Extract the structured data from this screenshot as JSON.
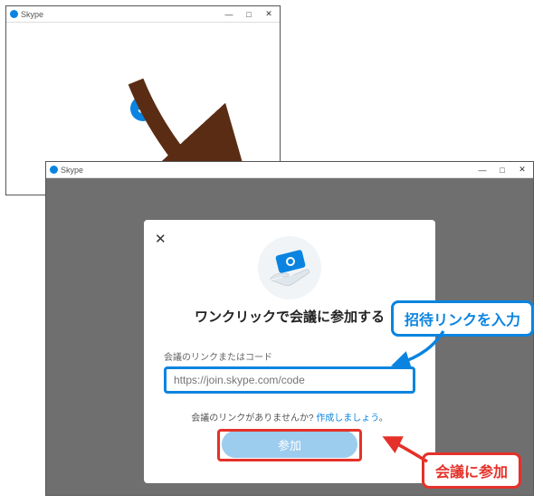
{
  "win1": {
    "title": "Skype",
    "minimize": "—",
    "maximize": "□",
    "close": "✕"
  },
  "win2": {
    "title": "Skype",
    "minimize": "—",
    "maximize": "□",
    "close": "✕",
    "modal": {
      "heading": "ワンクリックで会議に参加する",
      "field_label": "会議のリンクまたはコード",
      "placeholder": "https://join.skype.com/code",
      "helper_prefix": "会議のリンクがありませんか? ",
      "helper_link": "作成しましょう",
      "helper_suffix": "。",
      "join_label": "参加"
    }
  },
  "callouts": {
    "enter_link": "招待リンクを入力",
    "join_meeting": "会議に参加"
  }
}
